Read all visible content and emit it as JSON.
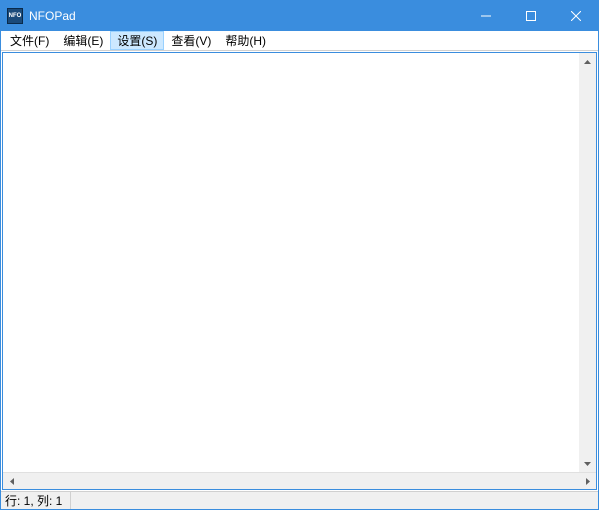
{
  "window": {
    "title": "NFOPad",
    "app_icon_label": "NFO"
  },
  "menubar": {
    "items": [
      {
        "label": "文件(F)"
      },
      {
        "label": "编辑(E)"
      },
      {
        "label": "设置(S)"
      },
      {
        "label": "查看(V)"
      },
      {
        "label": "帮助(H)"
      }
    ]
  },
  "editor": {
    "content": ""
  },
  "statusbar": {
    "position": "行: 1, 列: 1"
  }
}
